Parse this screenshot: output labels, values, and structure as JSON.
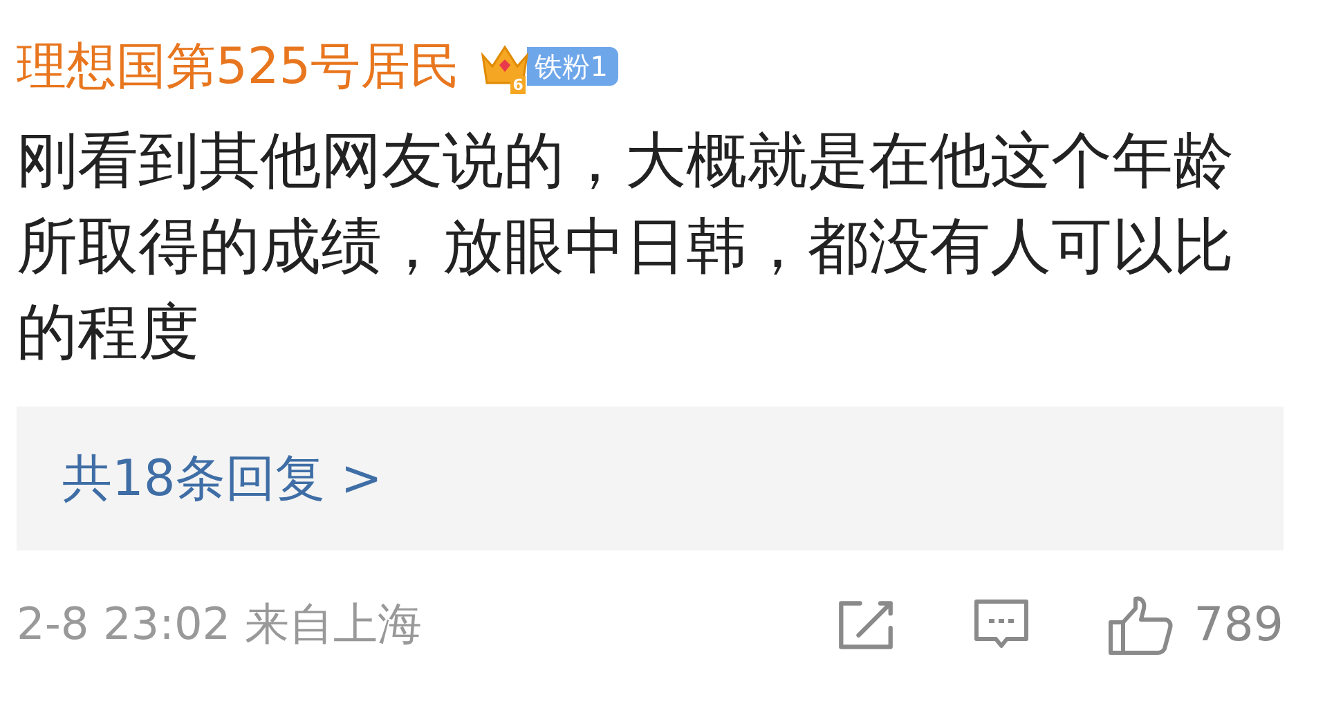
{
  "comment": {
    "username": "理想国第525号居民",
    "badge": {
      "level_mark": "6",
      "label": "铁粉1"
    },
    "text": "刚看到其他网友说的，大概就是在他这个年龄所取得的成绩，放眼中日韩，都没有人可以比的程度",
    "replies_link": "共18条回复 >",
    "meta": "2-8 23:02 来自上海",
    "like_count": "789"
  }
}
